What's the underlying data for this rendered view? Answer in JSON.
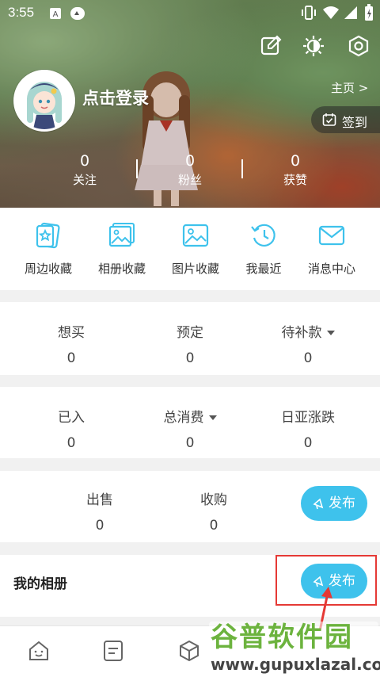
{
  "status": {
    "time": "3:55"
  },
  "header": {
    "login_label": "点击登录",
    "homepage_label": "主页 >",
    "checkin_label": "签到",
    "stats": [
      {
        "value": "0",
        "label": "关注"
      },
      {
        "value": "0",
        "label": "粉丝"
      },
      {
        "value": "0",
        "label": "获赞"
      }
    ]
  },
  "shortcuts": [
    {
      "label": "周边收藏",
      "icon": "card-star-icon"
    },
    {
      "label": "相册收藏",
      "icon": "album-icon"
    },
    {
      "label": "图片收藏",
      "icon": "picture-icon"
    },
    {
      "label": "我最近",
      "icon": "history-icon"
    },
    {
      "label": "消息中心",
      "icon": "mail-icon"
    }
  ],
  "wish": {
    "items": [
      {
        "title": "想买",
        "value": "0"
      },
      {
        "title": "预定",
        "value": "0"
      },
      {
        "title": "待补款",
        "value": "0"
      }
    ]
  },
  "owned": {
    "items": [
      {
        "title": "已入",
        "value": "0"
      },
      {
        "title": "总消费",
        "value": "0"
      },
      {
        "title": "日亚涨跌",
        "value": "0"
      }
    ]
  },
  "trade": {
    "items": [
      {
        "title": "出售",
        "value": "0"
      },
      {
        "title": "收购",
        "value": "0"
      }
    ],
    "publish_label": "发布"
  },
  "album": {
    "title": "我的相册",
    "publish_label": "发布"
  },
  "watermark": {
    "line1": "谷普软件园",
    "line2": "www.gupuxlazal.com"
  },
  "colors": {
    "accent": "#3ec2ec",
    "highlight": "#e53935"
  }
}
